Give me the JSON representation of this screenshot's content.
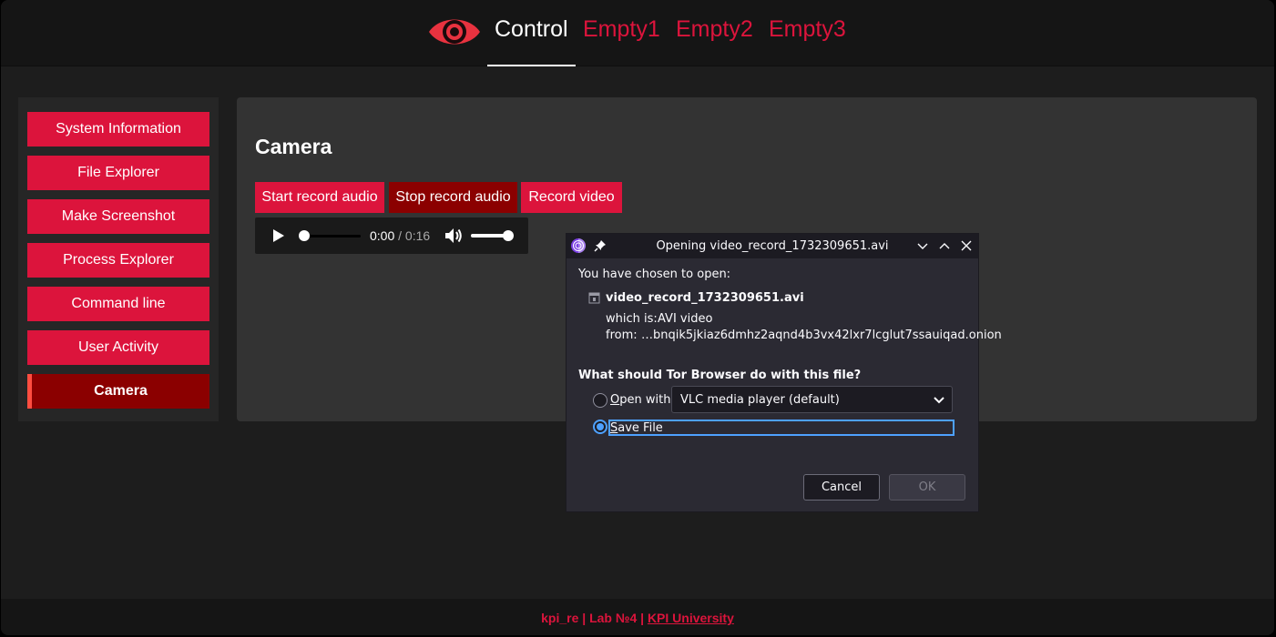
{
  "header": {
    "tabs": [
      {
        "label": "Control",
        "active": true
      },
      {
        "label": "Empty1",
        "active": false
      },
      {
        "label": "Empty2",
        "active": false
      },
      {
        "label": "Empty3",
        "active": false
      }
    ],
    "logo_icon": "eye-icon"
  },
  "sidebar": {
    "items": [
      {
        "label": "System Information"
      },
      {
        "label": "File Explorer"
      },
      {
        "label": "Make Screenshot"
      },
      {
        "label": "Process Explorer"
      },
      {
        "label": "Command line"
      },
      {
        "label": "User Activity"
      },
      {
        "label": "Camera",
        "active": true
      }
    ]
  },
  "panel": {
    "title": "Camera",
    "buttons": {
      "start_audio": "Start record audio",
      "stop_audio": "Stop record audio",
      "record_video": "Record video"
    },
    "audio": {
      "current_time": "0:00",
      "separator": " / ",
      "duration": "0:16",
      "progress": 0.0,
      "volume": 1.0
    }
  },
  "footer": {
    "text": "kpi_re | Lab №4 | ",
    "link": "KPI University"
  },
  "dialog": {
    "title": "Opening video_record_1732309651.avi",
    "intro": "You have chosen to open:",
    "filename": "video_record_1732309651.avi",
    "which_is_label": "which is:",
    "which_is_value": "AVI video",
    "from_label": "from:",
    "from_value": "…bnqik5jkiaz6dmhz2aqnd4b3vx42lxr7lcglut7ssauiqad.onion",
    "question": "What should Tor Browser do with this file?",
    "open_with_mnemonic": "O",
    "open_with_rest": "pen with",
    "open_with_app": "VLC media player (default)",
    "save_file_mnemonic": "S",
    "save_file_rest": "ave File",
    "selected_option": "save_file",
    "cancel_label": "Cancel",
    "ok_label": "OK"
  },
  "colors": {
    "accent": "#dc143c",
    "accent_dark": "#8b0000",
    "background": "#1d1d1d",
    "panel": "#333333",
    "dialog_bg": "#2b2a33",
    "focus": "#4ea1ff"
  }
}
